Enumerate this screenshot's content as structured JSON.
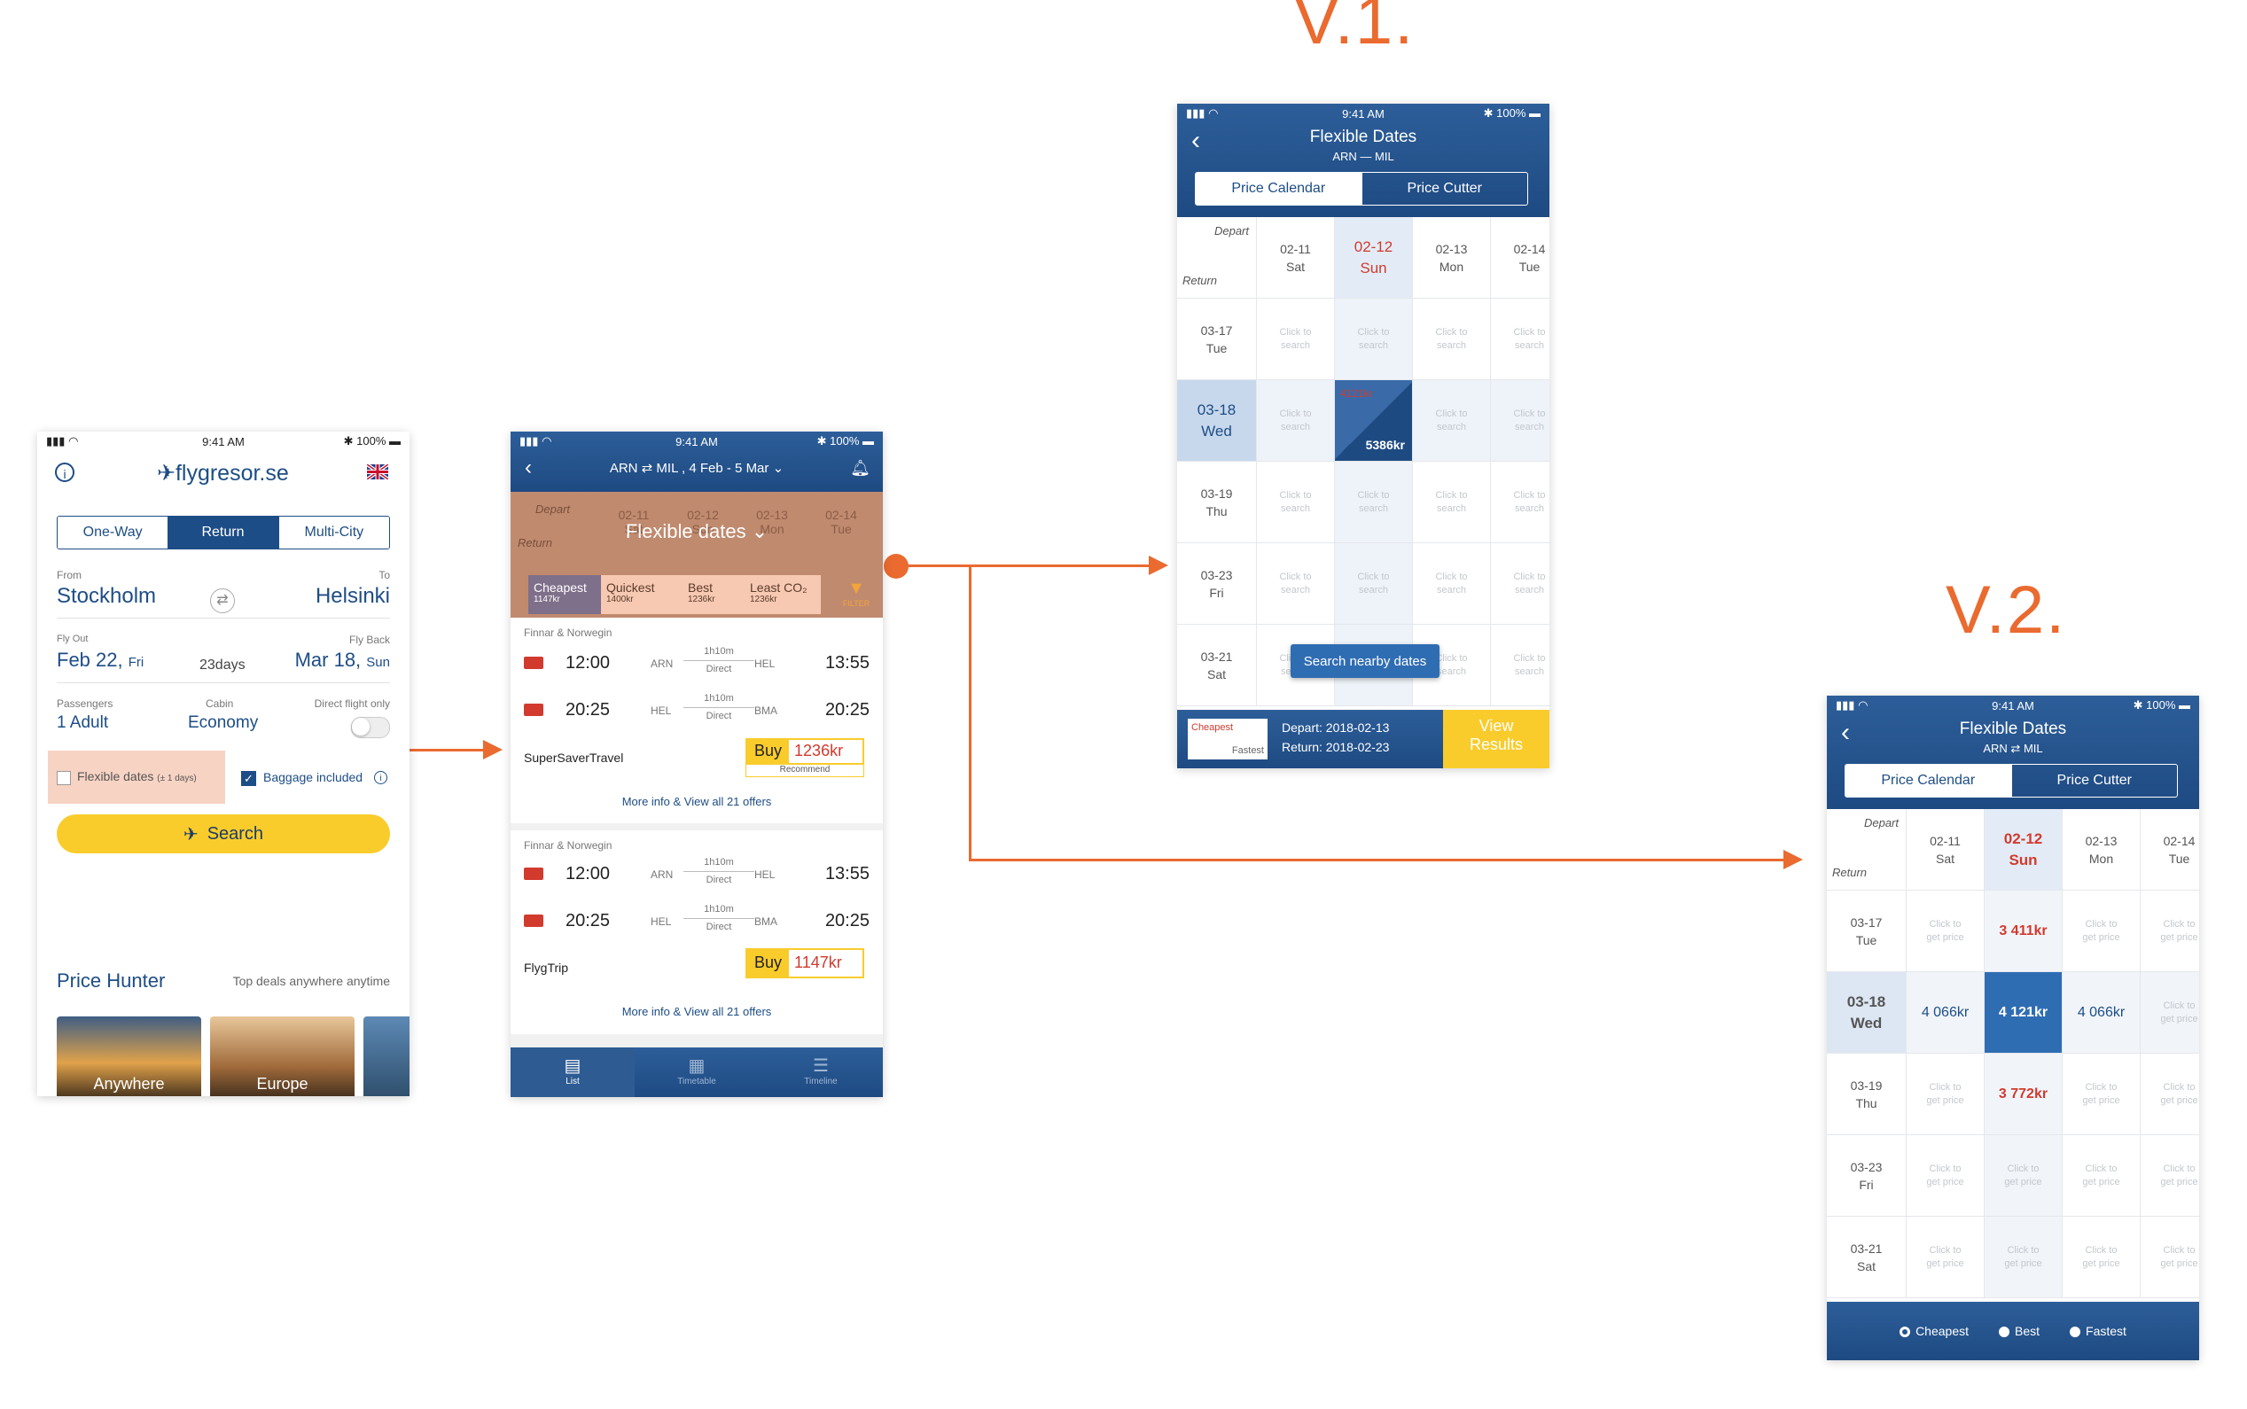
{
  "labels": {
    "v1": "V.1.",
    "v2": "V.2."
  },
  "colors": {
    "accent": "#ea6a2f",
    "navy": "#1d4d86",
    "yellow": "#f9cc2c",
    "red": "#d23a2e"
  },
  "screen1": {
    "status": {
      "time": "9:41 AM",
      "battery": "100%"
    },
    "logo": "flygresor.se",
    "info_icon": "info-icon",
    "flag_icon": "uk-flag-icon",
    "trip_tabs": [
      "One-Way",
      "Return",
      "Multi-City"
    ],
    "from_label": "From",
    "from_value": "Stockholm",
    "to_label": "To",
    "to_value": "Helsinki",
    "fly_out_label": "Fly Out",
    "fly_out_date": "Feb 22,",
    "fly_out_day": "Fri",
    "duration": "23days",
    "fly_back_label": "Fly Back",
    "fly_back_date": "Mar 18,",
    "fly_back_day": "Sun",
    "passengers_label": "Passengers",
    "passengers_value": "1 Adult",
    "cabin_label": "Cabin",
    "cabin_value": "Economy",
    "direct_label": "Direct flight only",
    "flexible_label": "Flexible dates",
    "flexible_note": "(± 1 days)",
    "baggage_label": "Baggage included",
    "search_button": "Search",
    "price_hunter_title": "Price Hunter",
    "price_hunter_sub": "Top deals anywhere anytime",
    "cards": [
      "Anywhere",
      "Europe"
    ]
  },
  "screen2": {
    "status": {
      "time": "9:41 AM",
      "battery": "100%"
    },
    "route": "ARN ⇄ MIL , 4 Feb - 5 Mar",
    "overlay_title": "Flexible dates",
    "bg_depart": "Depart",
    "bg_return": "Return",
    "bg_dates": [
      "02-11",
      "02-12",
      "02-13",
      "02-14"
    ],
    "bg_days": [
      "Sat",
      "Sun",
      "Mon",
      "Tue"
    ],
    "sort_tabs": [
      {
        "label": "Cheapest",
        "price": "1147kr"
      },
      {
        "label": "Quickest",
        "price": "1400kr"
      },
      {
        "label": "Best",
        "price": "1236kr"
      },
      {
        "label": "Least CO₂",
        "price": "1236kr"
      }
    ],
    "filter_label": "FILTER",
    "results": [
      {
        "airline": "Finnar & Norwegin",
        "legs": [
          {
            "dep": "12:00",
            "from": "ARN",
            "dur": "1h10m",
            "type": "Direct",
            "to": "HEL",
            "arr": "13:55"
          },
          {
            "dep": "20:25",
            "from": "HEL",
            "dur": "1h10m",
            "type": "Direct",
            "to": "BMA",
            "arr": "20:25"
          }
        ],
        "agent": "SuperSaverTravel",
        "buy": "Buy",
        "price": "1236kr",
        "badge": "Recommend",
        "more": "More info & View all 21 offers"
      },
      {
        "airline": "Finnar & Norwegin",
        "legs": [
          {
            "dep": "12:00",
            "from": "ARN",
            "dur": "1h10m",
            "type": "Direct",
            "to": "HEL",
            "arr": "13:55"
          },
          {
            "dep": "20:25",
            "from": "HEL",
            "dur": "1h10m",
            "type": "Direct",
            "to": "BMA",
            "arr": "20:25"
          }
        ],
        "agent": "FlygTrip",
        "buy": "Buy",
        "price": "1147kr",
        "badge": "",
        "more": "More info & View all 21 offers"
      }
    ],
    "bottom_tabs": [
      "List",
      "Timetable",
      "Timeline"
    ]
  },
  "screen3": {
    "status": {
      "time": "9:41 AM",
      "battery": "100%"
    },
    "title": "Flexible Dates",
    "subtitle": "ARN — MIL",
    "tabs": [
      "Price Calendar",
      "Price Cutter"
    ],
    "depart_label": "Depart",
    "return_label": "Return",
    "cols": [
      {
        "date": "02-11",
        "day": "Sat"
      },
      {
        "date": "02-12",
        "day": "Sun"
      },
      {
        "date": "02-13",
        "day": "Mon"
      },
      {
        "date": "02-14",
        "day": "Tue"
      }
    ],
    "rows": [
      {
        "date": "03-17",
        "day": "Tue"
      },
      {
        "date": "03-18",
        "day": "Wed"
      },
      {
        "date": "03-19",
        "day": "Thu"
      },
      {
        "date": "03-23",
        "day": "Fri"
      },
      {
        "date": "03-21",
        "day": "Sat"
      }
    ],
    "cell_hint": [
      "Click to",
      "search"
    ],
    "selected_price_top": "4121kr",
    "selected_price_bottom": "5386kr",
    "nearby_button": "Search nearby dates",
    "footer_cheapest": "Cheapest",
    "footer_fastest": "Fastest",
    "footer_depart": "Depart: 2018-02-13",
    "footer_return": "Return: 2018-02-23",
    "view_results": [
      "View",
      "Results"
    ]
  },
  "screen4": {
    "status": {
      "time": "9:41 AM",
      "battery": "100%"
    },
    "title": "Flexible Dates",
    "subtitle": "ARN ⇄ MIL",
    "tabs": [
      "Price Calendar",
      "Price Cutter"
    ],
    "depart_label": "Depart",
    "return_label": "Return",
    "cols": [
      {
        "date": "02-11",
        "day": "Sat"
      },
      {
        "date": "02-12",
        "day": "Sun"
      },
      {
        "date": "02-13",
        "day": "Mon"
      },
      {
        "date": "02-14",
        "day": "Tue"
      }
    ],
    "rows": [
      {
        "date": "03-17",
        "day": "Tue"
      },
      {
        "date": "03-18",
        "day": "Wed"
      },
      {
        "date": "03-19",
        "day": "Thu"
      },
      {
        "date": "03-23",
        "day": "Fri"
      },
      {
        "date": "03-21",
        "day": "Sat"
      }
    ],
    "cell_hint": [
      "Click to",
      "get price"
    ],
    "prices": [
      [
        "",
        "3 411kr",
        "",
        ""
      ],
      [
        "4 066kr",
        "4 121kr",
        "4 066kr",
        ""
      ],
      [
        "",
        "3 772kr",
        "",
        ""
      ],
      [
        "",
        "",
        "",
        ""
      ],
      [
        "",
        "",
        "",
        ""
      ]
    ],
    "footer_options": [
      "Cheapest",
      "Best",
      "Fastest"
    ]
  }
}
